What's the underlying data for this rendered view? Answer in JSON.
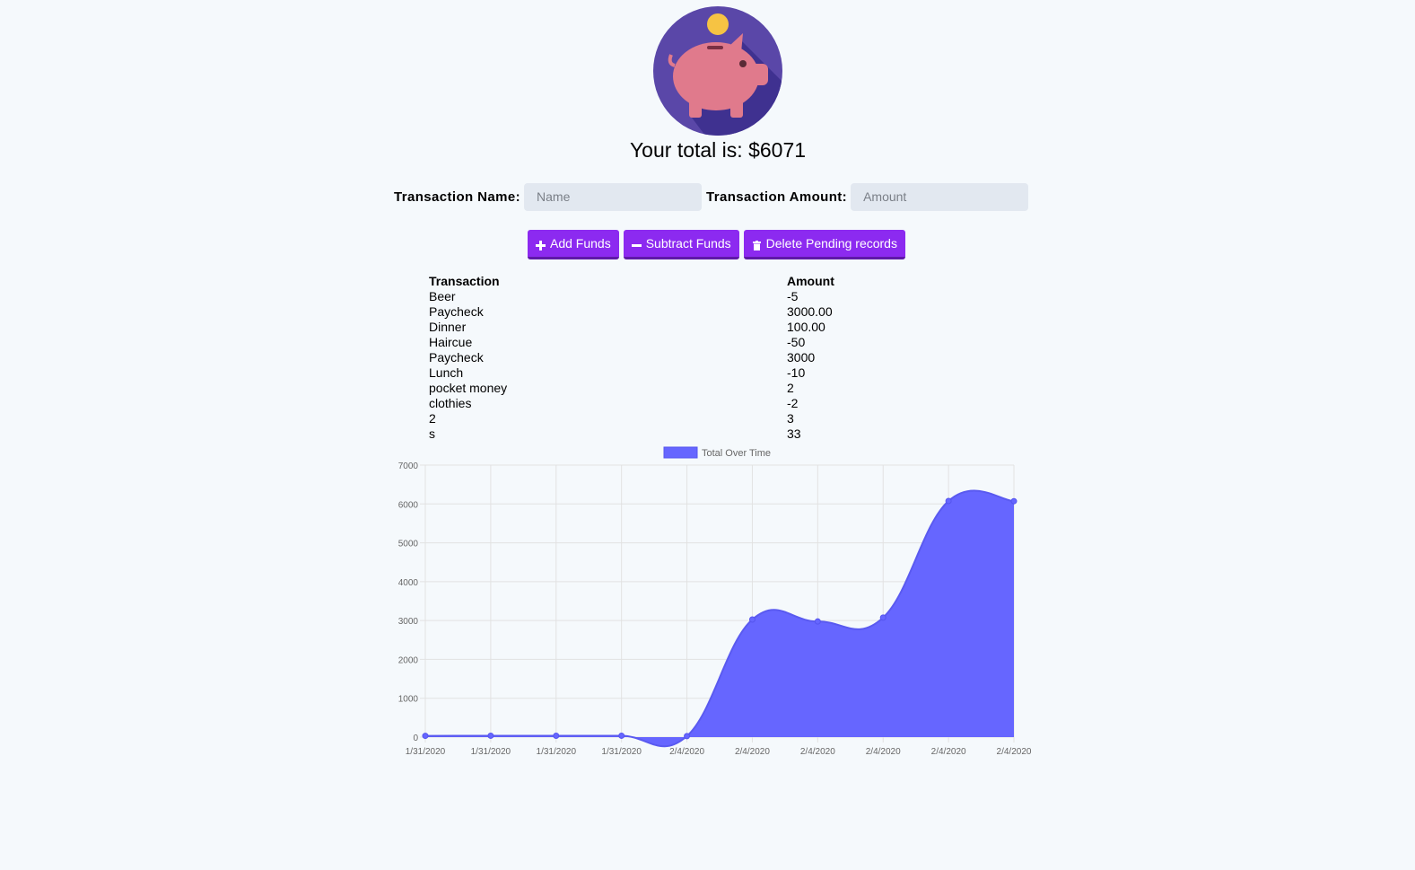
{
  "header": {
    "logo_icon": "piggy-bank-icon",
    "total_prefix": "Your total is: $",
    "total_value": "6071"
  },
  "form": {
    "name_label": "Transaction Name:",
    "name_placeholder": "Name",
    "amount_label": "Transaction Amount:",
    "amount_placeholder": "Amount"
  },
  "buttons": {
    "add": {
      "label": "Add Funds",
      "icon": "plus-icon"
    },
    "subtract": {
      "label": "Subtract Funds",
      "icon": "minus-icon"
    },
    "delete": {
      "label": "Delete Pending records",
      "icon": "trash-icon"
    }
  },
  "colors": {
    "button": "#8c2af0",
    "chart_fill": "#6666ff",
    "background": "#f5f9fc"
  },
  "table": {
    "headers": [
      "Transaction",
      "Amount"
    ],
    "rows": [
      [
        "Beer",
        "-5"
      ],
      [
        "Paycheck",
        "3000.00"
      ],
      [
        "Dinner",
        "100.00"
      ],
      [
        "Haircue",
        "-50"
      ],
      [
        "Paycheck",
        "3000"
      ],
      [
        "Lunch",
        "-10"
      ],
      [
        "pocket money",
        "2"
      ],
      [
        "clothies",
        "-2"
      ],
      [
        "2",
        "3"
      ],
      [
        "s",
        "33"
      ]
    ]
  },
  "chart_data": {
    "type": "area",
    "legend_label": "Total Over Time",
    "legend_position": "top",
    "grid": true,
    "x": [
      "1/31/2020",
      "1/31/2020",
      "1/31/2020",
      "1/31/2020",
      "2/4/2020",
      "2/4/2020",
      "2/4/2020",
      "2/4/2020",
      "2/4/2020",
      "2/4/2020"
    ],
    "series": [
      {
        "name": "Total Over Time",
        "values": [
          33,
          36,
          34,
          36,
          26,
          3026,
          2976,
          3076,
          6076,
          6071
        ]
      }
    ],
    "ylim": [
      0,
      7000
    ],
    "yticks": [
      0,
      1000,
      2000,
      3000,
      4000,
      5000,
      6000,
      7000
    ]
  }
}
